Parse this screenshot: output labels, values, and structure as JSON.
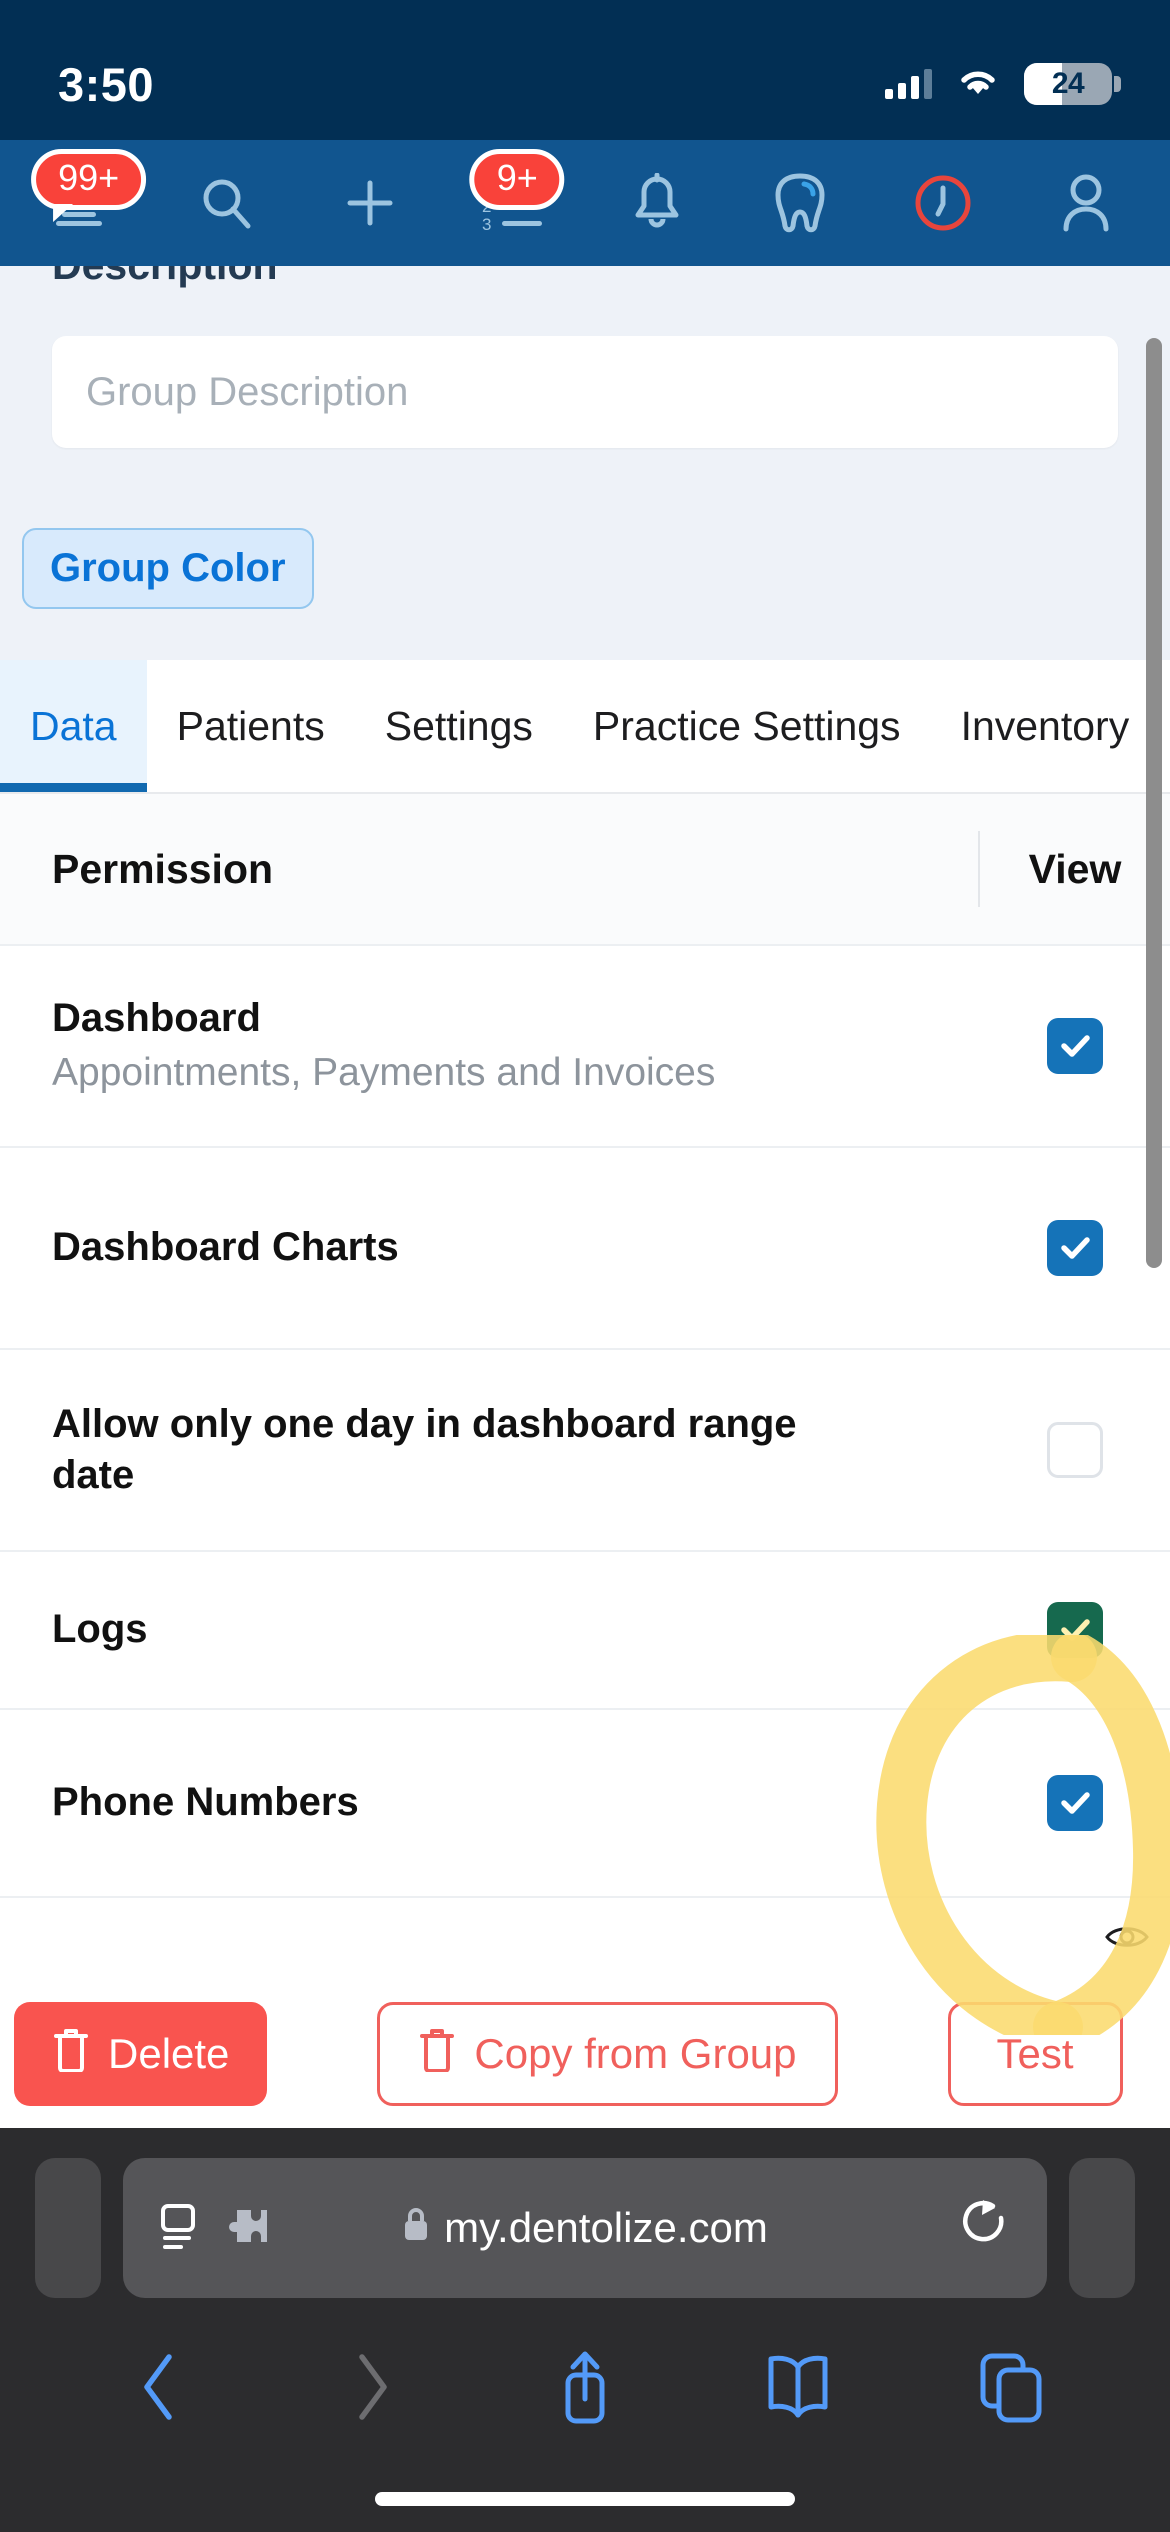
{
  "status_bar": {
    "time": "3:50",
    "battery_percent": "24",
    "signal_icon": "cellular-signal-icon",
    "wifi_icon": "wifi-icon",
    "battery_icon": "battery-icon"
  },
  "app_nav": {
    "menu_badge": "99+",
    "list_badge": "9+",
    "items": [
      {
        "name": "menu-icon",
        "label": "Menu"
      },
      {
        "name": "search-icon",
        "label": "Search"
      },
      {
        "name": "plus-icon",
        "label": "Add"
      },
      {
        "name": "numbered-list-icon",
        "label": "Tasks"
      },
      {
        "name": "bell-icon",
        "label": "Notifications"
      },
      {
        "name": "tooth-icon",
        "label": "Dental"
      },
      {
        "name": "clock-icon",
        "label": "Recent"
      },
      {
        "name": "user-icon",
        "label": "Profile"
      }
    ]
  },
  "form": {
    "description_label": "Description",
    "group_description_placeholder": "Group Description",
    "group_description_value": "",
    "group_color_label": "Group Color"
  },
  "tabs": [
    {
      "label": "Data",
      "active": true
    },
    {
      "label": "Patients",
      "active": false
    },
    {
      "label": "Settings",
      "active": false
    },
    {
      "label": "Practice Settings",
      "active": false
    },
    {
      "label": "Inventory",
      "active": false
    }
  ],
  "permissions_table": {
    "columns": [
      "Permission",
      "View"
    ],
    "rows": [
      {
        "title": "Dashboard",
        "subtitle": "Appointments, Payments and Invoices",
        "view_checked": true,
        "checkbox_state": "checked"
      },
      {
        "title": "Dashboard Charts",
        "subtitle": "",
        "view_checked": true,
        "checkbox_state": "checked"
      },
      {
        "title": "Allow only one day in dashboard range date",
        "subtitle": "",
        "view_checked": false,
        "checkbox_state": "unchecked"
      },
      {
        "title": "Logs",
        "subtitle": "",
        "view_checked": true,
        "checkbox_state": "checked"
      },
      {
        "title": "Phone Numbers",
        "subtitle": "",
        "view_checked": true,
        "checkbox_state": "checked"
      }
    ]
  },
  "annotations": {
    "highlight_shape": "yellow-circle-highlight",
    "highlight_color": "#fbdb6e",
    "eye_icon": "eye-icon"
  },
  "action_bar": {
    "delete_label": "Delete",
    "copy_label": "Copy from Group",
    "test_label": "Test"
  },
  "browser": {
    "url": "my.dentolize.com",
    "lock_icon": "lock-icon",
    "reader_icon": "reader-view-icon",
    "extension_icon": "extension-puzzle-icon",
    "reload_icon": "reload-icon",
    "toolbar": [
      {
        "name": "back-icon",
        "label": "Back",
        "enabled": true
      },
      {
        "name": "forward-icon",
        "label": "Forward",
        "enabled": false
      },
      {
        "name": "share-icon",
        "label": "Share",
        "enabled": true
      },
      {
        "name": "bookmarks-icon",
        "label": "Bookmarks",
        "enabled": true
      },
      {
        "name": "tabs-icon",
        "label": "Tabs",
        "enabled": true
      }
    ]
  },
  "colors": {
    "status_bg": "#022f54",
    "nav_bg": "#11558f",
    "page_bg": "#eef2f8",
    "accent_blue": "#0a73d6",
    "checkbox_blue": "#1573b8",
    "danger_red": "#f9544f",
    "badge_red": "#f9423a",
    "highlight_yellow": "#fbdb6e"
  }
}
